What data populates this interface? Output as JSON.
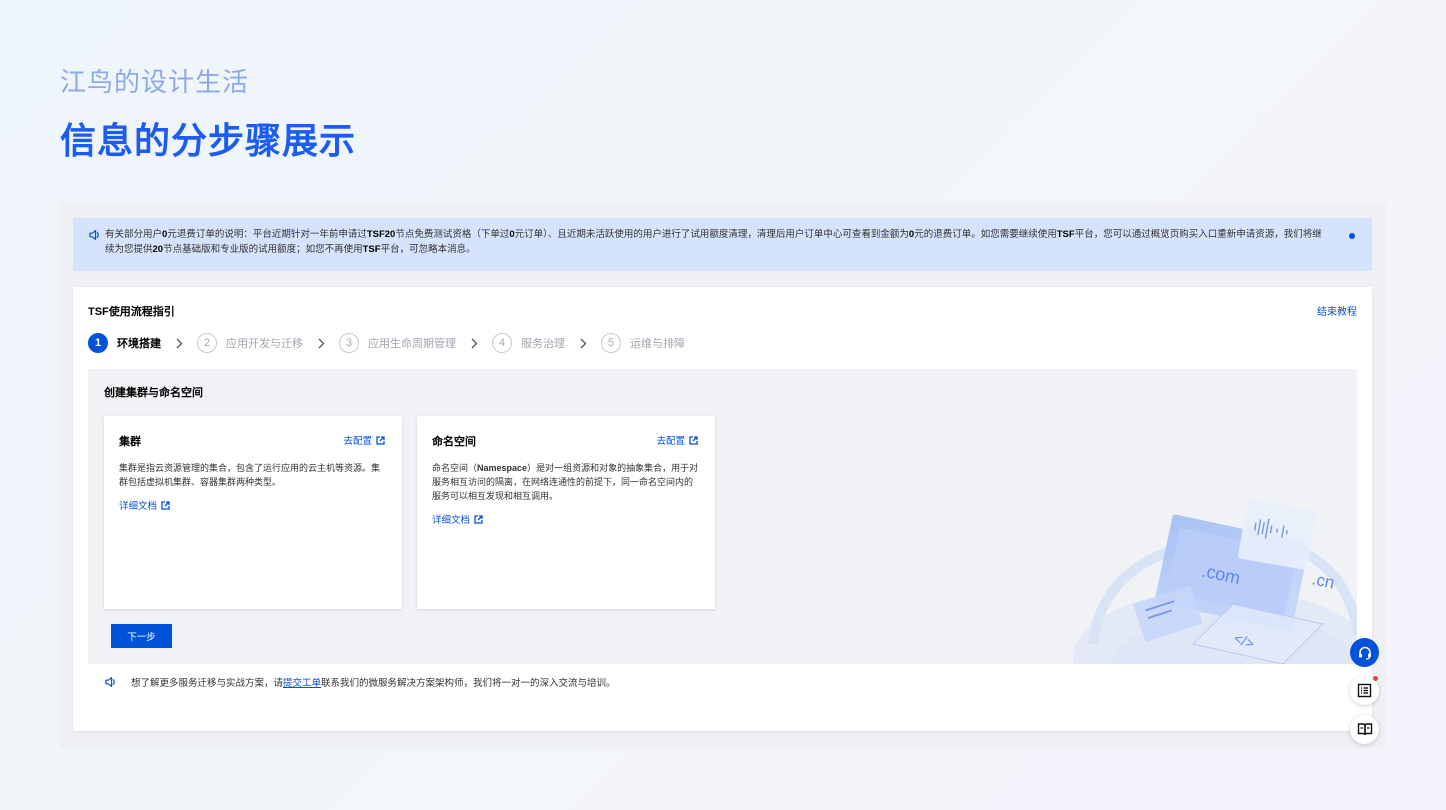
{
  "blog": {
    "subtitle": "江鸟的设计生活",
    "title": "信息的分步骤展示"
  },
  "notice": {
    "segments": [
      {
        "t": "有关部分用户",
        "b": false
      },
      {
        "t": "0",
        "b": true
      },
      {
        "t": "元退费订单的说明：平台近期针对一年前申请过",
        "b": false
      },
      {
        "t": "TSF20",
        "b": true
      },
      {
        "t": "节点免费测试资格（下单过",
        "b": false
      },
      {
        "t": "0",
        "b": true
      },
      {
        "t": "元订单）、且近期未活跃使用的用户进行了试用额度清理，清理后用户订单中心可查看到金额为",
        "b": false
      },
      {
        "t": "0",
        "b": true
      },
      {
        "t": "元的退费订单。如您需要继续使用",
        "b": false
      },
      {
        "t": "TSF",
        "b": true
      },
      {
        "t": "平台，您可以通过概览页购买入口重新申请资源，我们将继续为您提供",
        "b": false
      },
      {
        "t": "20",
        "b": true
      },
      {
        "t": "节点基础版和专业版的试用额度；如您不再使用",
        "b": false
      },
      {
        "t": "TSF",
        "b": true
      },
      {
        "t": "平台，可忽略本消息。",
        "b": false
      }
    ]
  },
  "guide": {
    "title": "TSF使用流程指引",
    "end_label": "结束教程",
    "steps": [
      {
        "num": "1",
        "label": "环境搭建",
        "active": true
      },
      {
        "num": "2",
        "label": "应用开发与迁移",
        "active": false
      },
      {
        "num": "3",
        "label": "应用生命周期管理",
        "active": false
      },
      {
        "num": "4",
        "label": "服务治理",
        "active": false
      },
      {
        "num": "5",
        "label": "运维与排障",
        "active": false
      }
    ]
  },
  "section": {
    "title": "创建集群与命名空间",
    "cards": [
      {
        "title": "集群",
        "link": "去配置",
        "desc": "集群是指云资源管理的集合，包含了运行应用的云主机等资源。集群包括虚拟机集群、容器集群两种类型。",
        "doc": "详细文档"
      },
      {
        "title": "命名空间",
        "link": "去配置",
        "desc_parts": [
          {
            "t": "命名空间（",
            "b": false
          },
          {
            "t": "Namespace",
            "b": true
          },
          {
            "t": "）是对一组资源和对象的抽象集合，用于对服务相互访问的隔离，在网络连通性的前提下，同一命名空间内的服务可以相互发现和相互调用。",
            "b": false
          }
        ],
        "doc": "详细文档"
      }
    ],
    "next_label": "下一步"
  },
  "illustration": {
    "text_com": ".com",
    "text_cn": ".cn",
    "text_code": "</>"
  },
  "tip": {
    "before": "想了解更多服务迁移与实战方案，请",
    "link": "提交工单",
    "after": "联系我们的微服务解决方案架构师，我们将一对一的深入交流与培训。"
  },
  "colors": {
    "brand": "#0052d9",
    "blog_title": "#1c5cf0",
    "notice_bg": "#d5e3fd",
    "badge_dot": "#e54545"
  },
  "icons": {
    "notice": "speaker-icon",
    "float": [
      "headset-icon",
      "list-icon",
      "book-icon"
    ]
  }
}
